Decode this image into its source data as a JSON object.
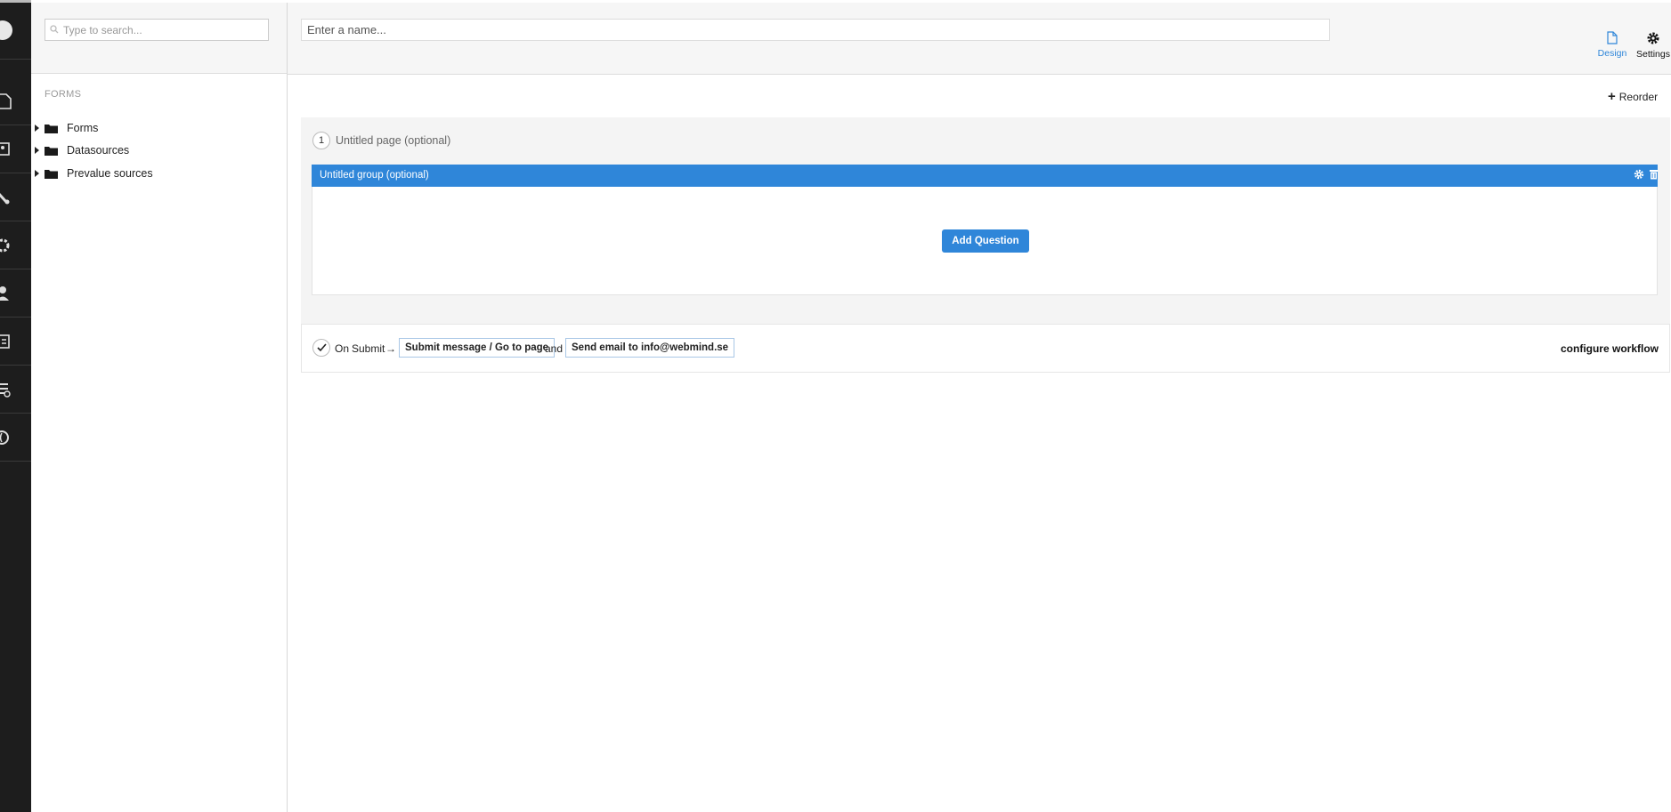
{
  "tree": {
    "search_placeholder": "Type to search...",
    "section_label": "FORMS",
    "items": [
      {
        "label": "Forms"
      },
      {
        "label": "Datasources"
      },
      {
        "label": "Prevalue sources"
      }
    ]
  },
  "header": {
    "name_placeholder": "Enter a name...",
    "design_label": "Design",
    "settings_label": "Settings"
  },
  "reorder_label": "Reorder",
  "page": {
    "number": "1",
    "title": "Untitled page (optional)",
    "group_title": "Untitled group (optional)",
    "add_question_label": "Add Question"
  },
  "workflow": {
    "on_label": "On",
    "submit_label": "Submit",
    "arrow": "→",
    "chip1": "Submit message / Go to page",
    "and_label": "and",
    "chip2": "Send email to info@webmind.se",
    "configure_label": "configure workflow"
  },
  "colors": {
    "accent": "#2f86d9",
    "rail": "#1d1d1d"
  }
}
